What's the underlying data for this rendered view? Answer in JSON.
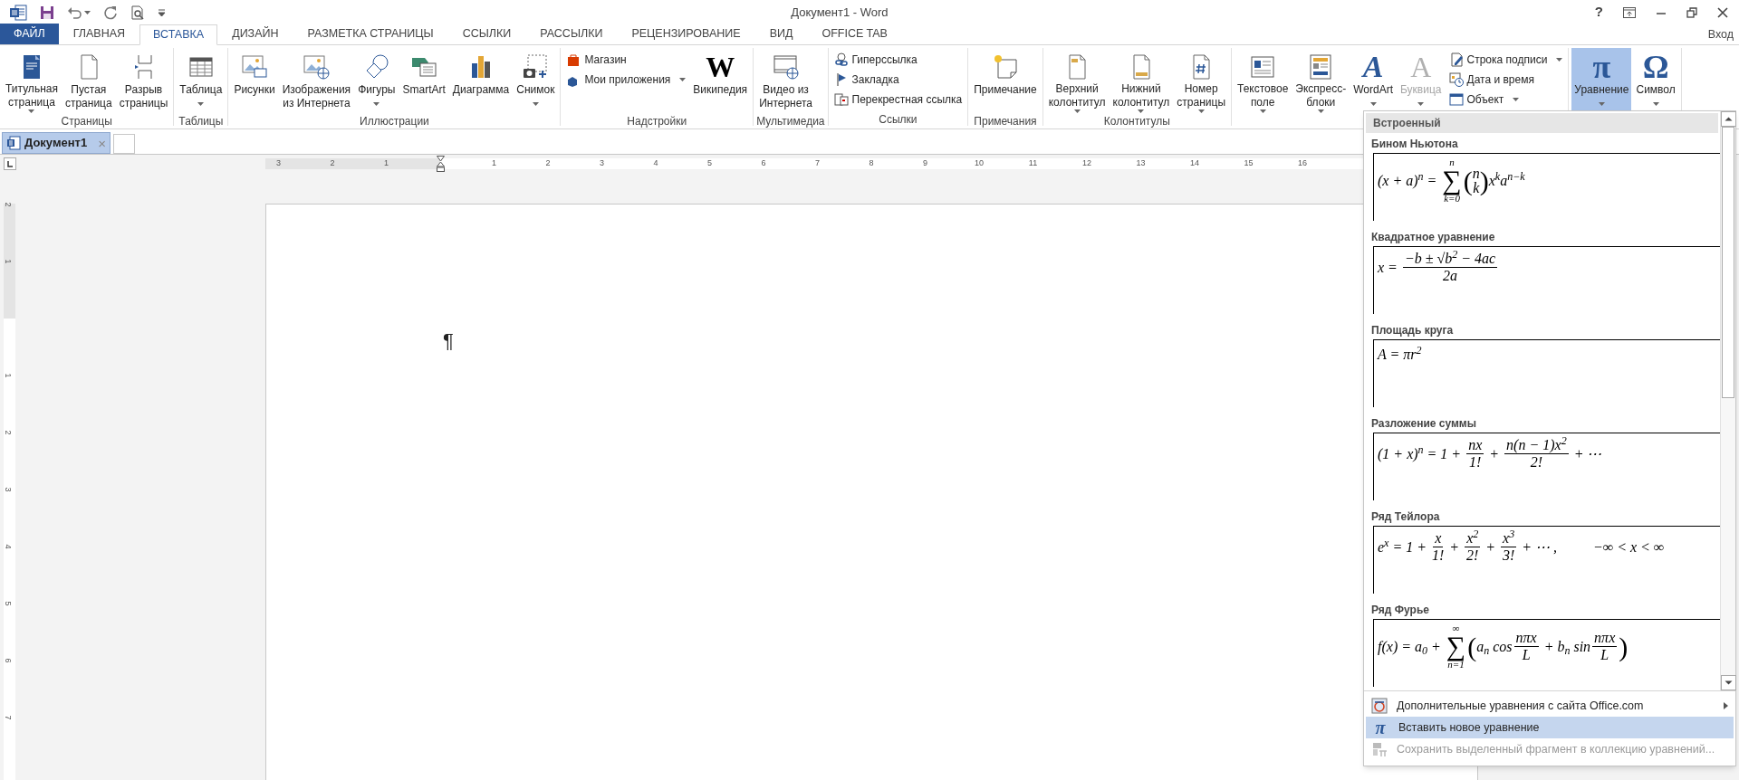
{
  "title_bar": {
    "title": "Документ1 - Word",
    "help": "?"
  },
  "tabs": [
    {
      "label": "ФАЙЛ",
      "kind": "file",
      "selected": false
    },
    {
      "label": "ГЛАВНАЯ",
      "kind": "tab",
      "selected": false
    },
    {
      "label": "ВСТАВКА",
      "kind": "tab",
      "selected": true
    },
    {
      "label": "ДИЗАЙН",
      "kind": "tab",
      "selected": false
    },
    {
      "label": "РАЗМЕТКА СТРАНИЦЫ",
      "kind": "tab",
      "selected": false
    },
    {
      "label": "ССЫЛКИ",
      "kind": "tab",
      "selected": false
    },
    {
      "label": "РАССЫЛКИ",
      "kind": "tab",
      "selected": false
    },
    {
      "label": "РЕЦЕНЗИРОВАНИЕ",
      "kind": "tab",
      "selected": false
    },
    {
      "label": "ВИД",
      "kind": "tab",
      "selected": false
    },
    {
      "label": "OFFICE TAB",
      "kind": "tab",
      "selected": false
    }
  ],
  "account": "Вход",
  "ribbon": {
    "groups": [
      {
        "label": "Страницы",
        "items": [
          {
            "kind": "large",
            "lines": [
              "Титульная",
              "страница"
            ],
            "dropdown": true,
            "pressed": false,
            "disabled": false
          },
          {
            "kind": "large",
            "lines": [
              "Пустая",
              "страница"
            ],
            "dropdown": false,
            "pressed": false,
            "disabled": false
          },
          {
            "kind": "large",
            "lines": [
              "Разрыв",
              "страницы"
            ],
            "dropdown": false,
            "pressed": false,
            "disabled": false
          }
        ]
      },
      {
        "label": "Таблицы",
        "items": [
          {
            "kind": "large",
            "lines": [
              "Таблица"
            ],
            "dropdown": true,
            "pressed": false,
            "disabled": false
          }
        ]
      },
      {
        "label": "Иллюстрации",
        "items": [
          {
            "kind": "large",
            "lines": [
              "Рисунки"
            ],
            "dropdown": false,
            "pressed": false,
            "disabled": false
          },
          {
            "kind": "large",
            "lines": [
              "Изображения",
              "из Интернета"
            ],
            "dropdown": false,
            "pressed": false,
            "disabled": false
          },
          {
            "kind": "large",
            "lines": [
              "Фигуры"
            ],
            "dropdown": true,
            "pressed": false,
            "disabled": false
          },
          {
            "kind": "large",
            "lines": [
              "SmartArt"
            ],
            "dropdown": false,
            "pressed": false,
            "disabled": false
          },
          {
            "kind": "large",
            "lines": [
              "Диаграмма"
            ],
            "dropdown": false,
            "pressed": false,
            "disabled": false
          },
          {
            "kind": "large",
            "lines": [
              "Снимок"
            ],
            "dropdown": true,
            "pressed": false,
            "disabled": false
          }
        ]
      },
      {
        "label": "Надстройки",
        "items": [
          {
            "kind": "stack",
            "buttons": [
              {
                "label": "Магазин",
                "dropdown": false
              },
              {
                "label": "Мои приложения",
                "dropdown": true
              }
            ]
          },
          {
            "kind": "large",
            "lines": [
              "Википедия"
            ],
            "glyph": "W",
            "dropdown": false,
            "pressed": false,
            "disabled": false
          }
        ]
      },
      {
        "label": "Мультимедиа",
        "items": [
          {
            "kind": "large",
            "lines": [
              "Видео из",
              "Интернета"
            ],
            "dropdown": false,
            "pressed": false,
            "disabled": false
          }
        ]
      },
      {
        "label": "Ссылки",
        "items": [
          {
            "kind": "stack",
            "buttons": [
              {
                "label": "Гиперссылка",
                "dropdown": false
              },
              {
                "label": "Закладка",
                "dropdown": false
              },
              {
                "label": "Перекрестная ссылка",
                "dropdown": false
              }
            ]
          }
        ]
      },
      {
        "label": "Примечания",
        "items": [
          {
            "kind": "large",
            "lines": [
              "Примечание"
            ],
            "dropdown": false,
            "pressed": false,
            "disabled": false
          }
        ]
      },
      {
        "label": "Колонтитулы",
        "items": [
          {
            "kind": "large",
            "lines": [
              "Верхний",
              "колонтитул"
            ],
            "dropdown": true,
            "pressed": false,
            "disabled": false
          },
          {
            "kind": "large",
            "lines": [
              "Нижний",
              "колонтитул"
            ],
            "dropdown": true,
            "pressed": false,
            "disabled": false
          },
          {
            "kind": "large",
            "lines": [
              "Номер",
              "страницы"
            ],
            "dropdown": true,
            "pressed": false,
            "disabled": false
          }
        ]
      },
      {
        "items": [
          {
            "kind": "large",
            "lines": [
              "Текстовое",
              "поле"
            ],
            "dropdown": true,
            "pressed": false,
            "disabled": false
          },
          {
            "kind": "large",
            "lines": [
              "Экспресс-",
              "блоки"
            ],
            "dropdown": true,
            "pressed": false,
            "disabled": false
          },
          {
            "kind": "large",
            "lines": [
              "WordArt"
            ],
            "glyph": "A",
            "dropdown": true,
            "pressed": false,
            "disabled": false
          },
          {
            "kind": "large",
            "lines": [
              "Буквица"
            ],
            "glyph": "A",
            "dropdown": true,
            "pressed": false,
            "disabled": true
          },
          {
            "kind": "stack",
            "buttons": [
              {
                "label": "Строка подписи",
                "dropdown": true
              },
              {
                "label": "Дата и время",
                "dropdown": false
              },
              {
                "label": "Объект",
                "dropdown": true
              }
            ]
          }
        ]
      },
      {
        "items": [
          {
            "kind": "large",
            "lines": [
              "Уравнение"
            ],
            "glyph": "π",
            "dropdown": true,
            "pressed": true,
            "disabled": false
          },
          {
            "kind": "large",
            "lines": [
              "Символ"
            ],
            "glyph": "Ω",
            "dropdown": true,
            "pressed": false,
            "disabled": false
          }
        ]
      }
    ]
  },
  "document_tabs": [
    {
      "label": "Документ1",
      "close": "×",
      "selected": true
    }
  ],
  "ruler": {
    "horizontal": [
      "3",
      "2",
      "1",
      "1",
      "2",
      "3",
      "4",
      "5",
      "6",
      "7",
      "8",
      "9",
      "10",
      "11",
      "12",
      "13",
      "14",
      "15",
      "16"
    ],
    "vertical": [
      "2",
      "1",
      "1",
      "2",
      "3",
      "4",
      "5",
      "6",
      "7"
    ]
  },
  "document": {
    "paragraph_mark": "¶"
  },
  "equation_menu": {
    "header": "Встроенный",
    "equations": [
      {
        "title": "Бином Ньютона",
        "parts": [
          {
            "kind": "t",
            "text": "(x + a)$^{n}$ = "
          },
          {
            "kind": "sum",
            "sign": "∑",
            "over": "n",
            "under": "k=0"
          },
          {
            "kind": "binom",
            "open": "(",
            "top": "n",
            "bottom": "k",
            "close": ")"
          },
          {
            "kind": "t",
            "text": "x$^{k}$a$^{n−k}$"
          }
        ]
      },
      {
        "title": "Квадратное уравнение",
        "parts": [
          {
            "kind": "t",
            "text": "x = "
          },
          {
            "kind": "frac",
            "num": "−b ± √b$^{2}$ − 4ac",
            "den": "2a"
          }
        ]
      },
      {
        "title": "Площадь круга",
        "parts": [
          {
            "kind": "t",
            "text": "A = πr$^{2}$"
          }
        ]
      },
      {
        "title": "Разложение суммы",
        "parts": [
          {
            "kind": "t",
            "text": "(1 + x)$^{n}$ = 1 + "
          },
          {
            "kind": "frac",
            "num": "nx",
            "den": "1!"
          },
          {
            "kind": "t",
            "text": " + "
          },
          {
            "kind": "frac",
            "num": "n(n − 1)x$^{2}$",
            "den": "2!"
          },
          {
            "kind": "t",
            "text": " + ⋯"
          }
        ]
      },
      {
        "title": "Ряд Тейлора",
        "parts": [
          {
            "kind": "t",
            "text": "e$^{x}$ = 1 + "
          },
          {
            "kind": "frac",
            "num": "x",
            "den": "1!"
          },
          {
            "kind": "t",
            "text": " + "
          },
          {
            "kind": "frac",
            "num": "x$^{2}$",
            "den": "2!"
          },
          {
            "kind": "t",
            "text": " + "
          },
          {
            "kind": "frac",
            "num": "x$^{3}$",
            "den": "3!"
          },
          {
            "kind": "t",
            "text": " + ⋯ ,"
          },
          {
            "kind": "space"
          },
          {
            "kind": "t",
            "text": "−∞ < x < ∞"
          }
        ]
      },
      {
        "title": "Ряд Фурье",
        "parts": [
          {
            "kind": "t",
            "text": "f(x) = a$_{0}$ + "
          },
          {
            "kind": "sum",
            "sign": "∑",
            "over": "∞",
            "under": "n=1"
          },
          {
            "kind": "t",
            "text": "(",
            "big": true
          },
          {
            "kind": "t",
            "text": "a$_{n}$ cos"
          },
          {
            "kind": "frac",
            "num": "nπx",
            "den": "L"
          },
          {
            "kind": "t",
            "text": " + b$_{n}$ sin"
          },
          {
            "kind": "frac",
            "num": "nπx",
            "den": "L"
          },
          {
            "kind": "t",
            "text": ")",
            "big": true
          }
        ]
      }
    ],
    "commands": [
      {
        "label": "Дополнительные уравнения с сайта Office.com",
        "submenu": true,
        "highlighted": false,
        "disabled": false
      },
      {
        "label": "Вставить новое уравнение",
        "glyph": "π",
        "submenu": false,
        "highlighted": true,
        "disabled": false
      },
      {
        "label": "Сохранить выделенный фрагмент в коллекцию уравнений...",
        "submenu": false,
        "highlighted": false,
        "disabled": true
      }
    ]
  }
}
